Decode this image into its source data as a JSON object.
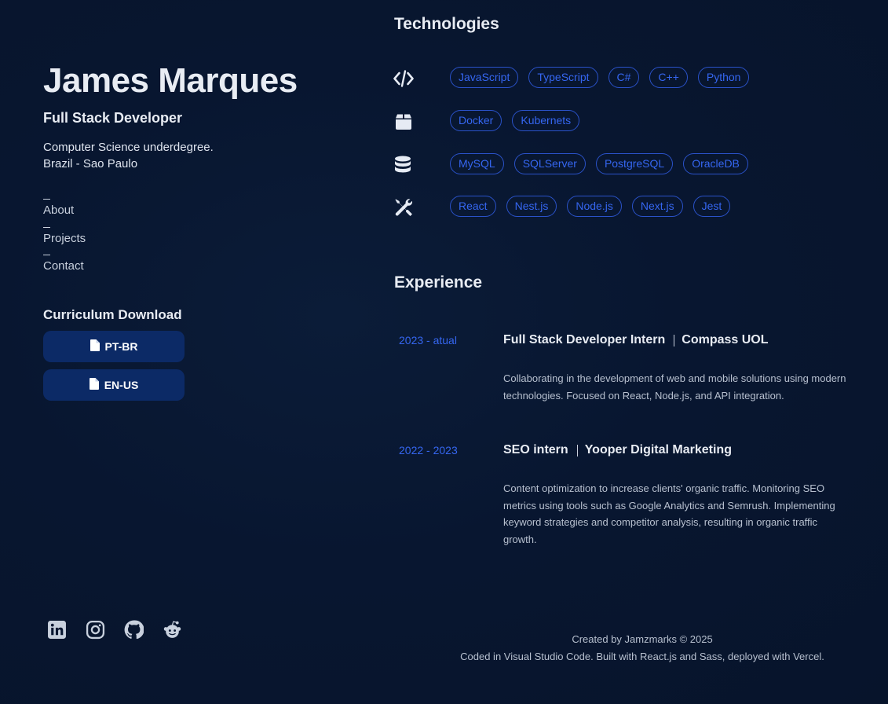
{
  "profile": {
    "name": "James Marques",
    "role": "Full Stack Developer",
    "bio_line1": "Computer Science underdegree.",
    "bio_line2": "Brazil - Sao Paulo"
  },
  "nav": {
    "items": [
      {
        "label": "About"
      },
      {
        "label": "Projects"
      },
      {
        "label": "Contact"
      }
    ]
  },
  "curriculum": {
    "title": "Curriculum Download",
    "buttons": [
      {
        "label": "PT-BR",
        "icon": "file-icon"
      },
      {
        "label": "EN-US",
        "icon": "file-icon"
      }
    ]
  },
  "socials": [
    {
      "icon": "linkedin-icon"
    },
    {
      "icon": "instagram-icon"
    },
    {
      "icon": "github-icon"
    },
    {
      "icon": "reddit-icon"
    }
  ],
  "technologies": {
    "title": "Technologies",
    "rows": [
      {
        "icon": "code-icon",
        "tags": [
          "JavaScript",
          "TypeScript",
          "C#",
          "C++",
          "Python"
        ]
      },
      {
        "icon": "box-icon",
        "tags": [
          "Docker",
          "Kubernets"
        ]
      },
      {
        "icon": "database-icon",
        "tags": [
          "MySQL",
          "SQLServer",
          "PostgreSQL",
          "OracleDB"
        ]
      },
      {
        "icon": "tools-icon",
        "tags": [
          "React",
          "Nest.js",
          "Node.js",
          "Next.js",
          "Jest"
        ]
      }
    ]
  },
  "experience": {
    "title": "Experience",
    "items": [
      {
        "period": "2023 - atual",
        "position": "Full Stack Developer Intern",
        "company": "Compass UOL",
        "description": "Collaborating in the development of web and mobile solutions using modern technologies. Focused on React, Node.js, and API integration."
      },
      {
        "period": "2022 - 2023",
        "position": "SEO intern",
        "company": "Yooper Digital Marketing",
        "description": "Content optimization to increase clients' organic traffic. Monitoring SEO metrics using tools such as Google Analytics and Semrush. Implementing keyword strategies and competitor analysis, resulting in organic traffic growth."
      }
    ]
  },
  "footer": {
    "line1": "Created by Jamzmarks © 2025",
    "line2": "Coded in Visual Studio Code. Built with React.js and Sass, deployed with Vercel."
  },
  "colors": {
    "background": "#081630",
    "accent": "#3566f0",
    "button": "#0c2a66",
    "text": "#e8ecf3"
  }
}
